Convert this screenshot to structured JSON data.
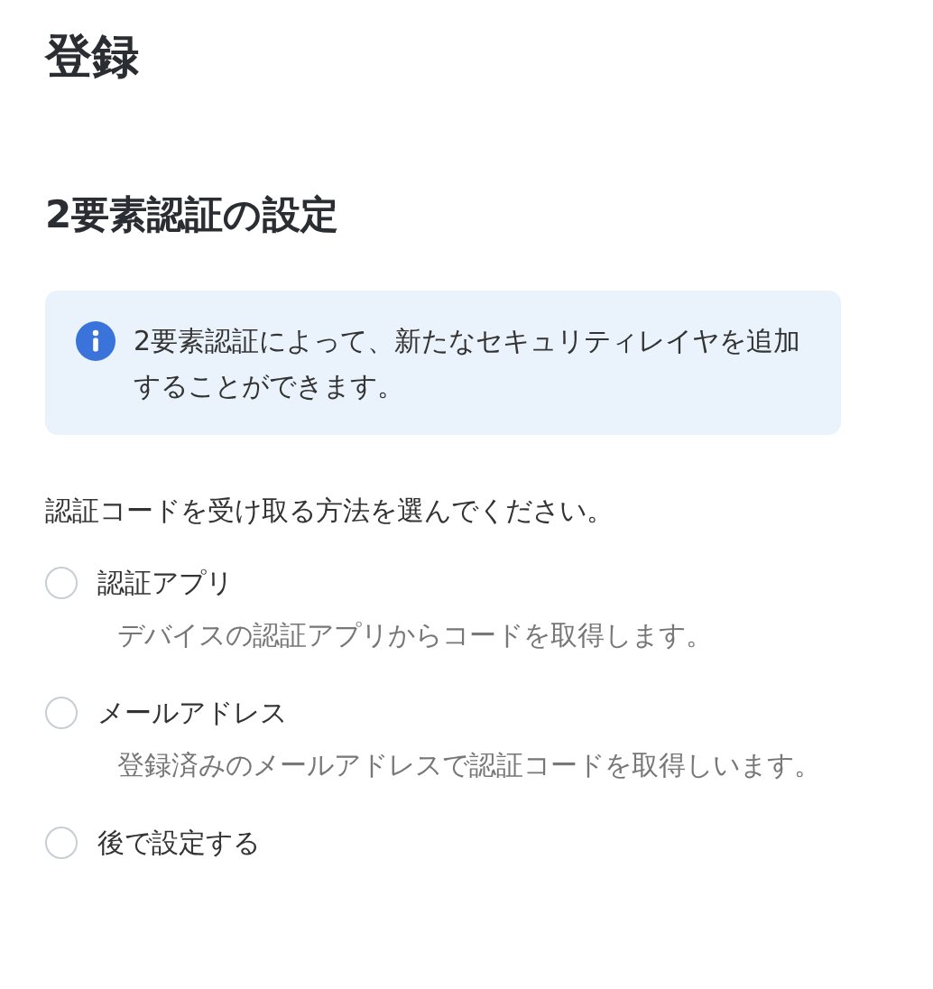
{
  "page_title": "登録",
  "section_title": "2要素認証の設定",
  "info_note": {
    "text": "2要素認証によって、新たなセキュリティレイヤを追加することができます。"
  },
  "prompt": "認証コードを受け取る方法を選んでください。",
  "options": [
    {
      "label": "認証アプリ",
      "description": "デバイスの認証アプリからコードを取得します。",
      "selected": false
    },
    {
      "label": "メールアドレス",
      "description": "登録済みのメールアドレスで認証コードを取得しいます。",
      "selected": false
    },
    {
      "label": "後で設定する",
      "selected": false
    }
  ]
}
